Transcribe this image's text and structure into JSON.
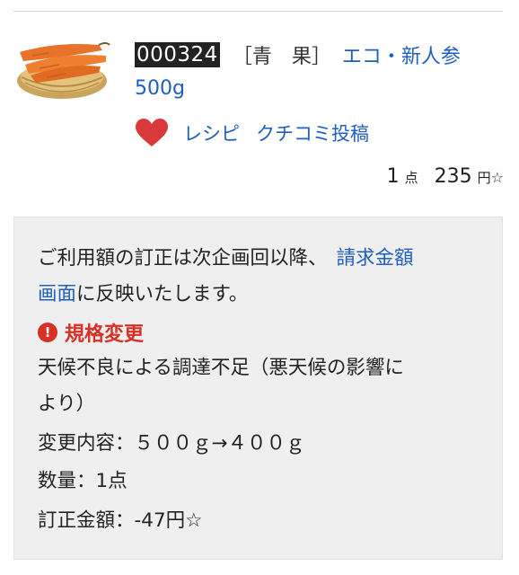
{
  "item": {
    "code": "000324",
    "category": "［青　果］",
    "name": "エコ・新人参",
    "size": "500g",
    "recipe_label": "レシピ",
    "review_label": "クチコミ投稿",
    "quantity": "1",
    "quantity_unit": "点",
    "price": "235",
    "price_unit": "円",
    "price_mark": "☆",
    "image_icon": "carrots-basket-image",
    "favorite_icon": "heart-icon",
    "favorite_color": "#d9393a"
  },
  "notice": {
    "line1_prefix": "ご利用額の訂正は次企画回以降、",
    "line1_link": "請求金額",
    "line2_link": "画面",
    "line2_suffix": "に反映いたします。",
    "alert_icon": "!",
    "alert_title": "規格変更",
    "reason_line1": "天候不良による調達不足（悪天候の影響に",
    "reason_line2": "より）",
    "change_detail": "変更内容：５００ｇ→４００ｇ",
    "quantity_detail": "数量：1点",
    "amount_detail": "訂正金額：-47円☆",
    "alert_color": "#d93025",
    "link_color": "#1f5fbf"
  }
}
